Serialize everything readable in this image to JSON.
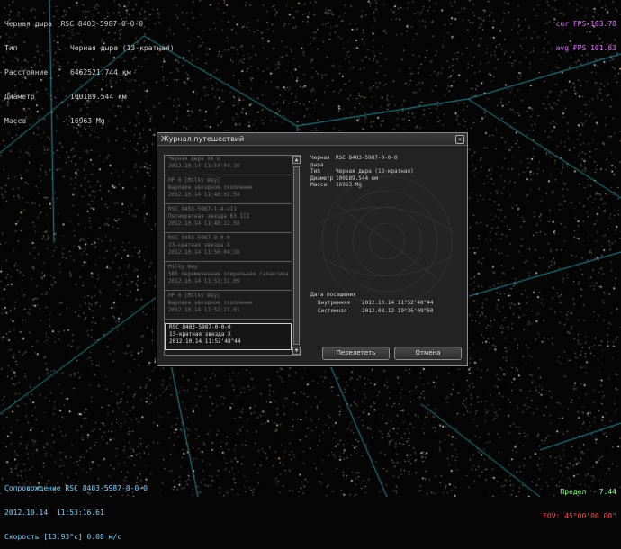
{
  "hud": {
    "object_name": "Черная дыра  RSC 8403-5987-0-0-0",
    "rows": [
      {
        "key": "Тип",
        "value": "Черная дыра (13-кратная)"
      },
      {
        "key": "Расстояние",
        "value": "6462521.744 км"
      },
      {
        "key": "Диаметр",
        "value": "100189.544 км"
      },
      {
        "key": "Масса",
        "value": "16963 Mg"
      }
    ],
    "cur_fps": "cur FPS 103.78",
    "avg_fps": "avg FPS 101.63",
    "follow": "Сопровождение RSC 8403-5987-0-0-0",
    "datetime": "2012.10.14  11:53:16.61",
    "speed": "Скорость [13.93°c] 0.08 м/с",
    "limit": "Предел   7.44",
    "fov": "FOV: 45°00'00.00\""
  },
  "dialog": {
    "title": "Журнал путешествий",
    "close_glyph": "×",
    "history": [
      {
        "name": "Черная дыра ХХ Ц",
        "date": "2012.10.14  11:54:04.19",
        "selected": false
      },
      {
        "name": "HP 6 [Milky Way]",
        "sub": "Шаровое звездное скопление",
        "date": "2012.10.14  11:48:02.54",
        "selected": false
      },
      {
        "name": "RSC  8403-5987-1-4-u11",
        "sub": "Пятикратная звезда K3 III",
        "date": "2012.10.14  11:48:22.58",
        "selected": false
      },
      {
        "name": "RSC  8403-5987-0-0-0",
        "sub": "13-кратная звезда X",
        "date": "2012.10.14  11:50:04:28",
        "selected": false
      },
      {
        "name": "Milky Way",
        "sub": "SBb перемеченная спиральная галактика",
        "date": "2012.10.14  11:51:31.09",
        "selected": false
      },
      {
        "name": "HP 6 [Milky Way]",
        "sub": "Шаровое звездное скопление",
        "date": "2012.10.14  11:52:21.01",
        "selected": false
      },
      {
        "name": "RSC  8403-5987-0-0-0",
        "sub": "13-кратная звезда X",
        "date": "2012.10.14  11:52'48\"44",
        "selected": true
      }
    ],
    "scroll_up": "▲",
    "scroll_down": "▼",
    "info": {
      "rows": [
        {
          "key": "Черная дыра",
          "value": "RSC  8403-5987-0-0-0"
        },
        {
          "key": "Тип",
          "value": "Черная дыра (13-кратная)"
        },
        {
          "key": "Диаметр",
          "value": "100189.544 км"
        },
        {
          "key": "Масса",
          "value": "16963 Mg"
        }
      ]
    },
    "visit": {
      "title": "Дата посещения",
      "rows": [
        {
          "key": "Внутренняя",
          "value": "2012.10.14  11°52'48\"44"
        },
        {
          "key": "Системная",
          "value": "2012.08.12  19°36'09\"50"
        }
      ]
    },
    "goto_label": "Перелететь",
    "cancel_label": "Отмена"
  },
  "colors": {
    "hud_fps": "#e070ff",
    "hud_follow": "#7fd0ff",
    "hud_limit": "#88ff88",
    "hud_fov": "#ff5050",
    "constellation_lines": "#2a8fa0"
  }
}
